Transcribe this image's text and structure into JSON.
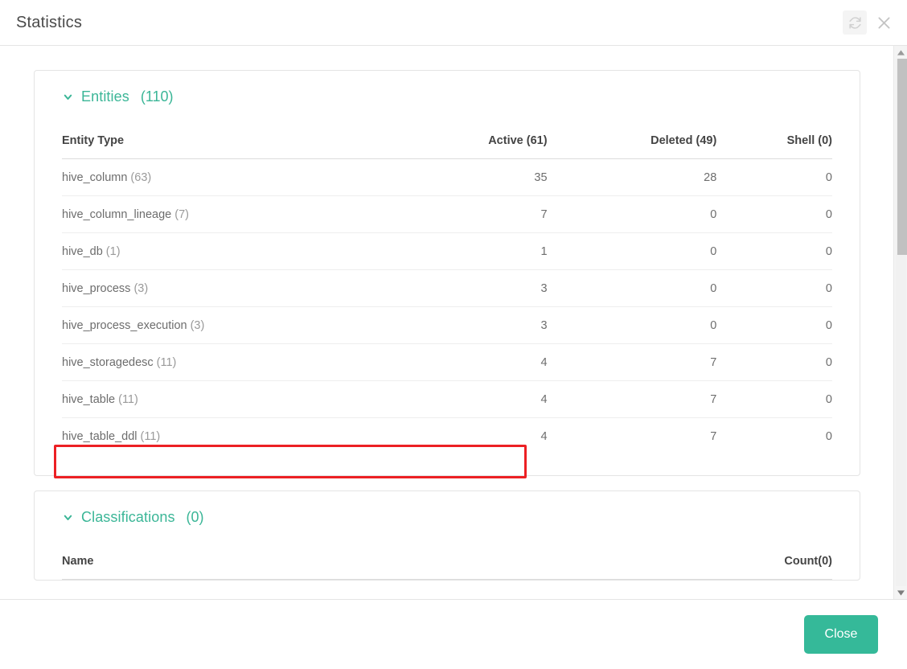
{
  "header": {
    "title": "Statistics",
    "refresh_icon": "refresh-icon",
    "close_icon": "close-icon"
  },
  "entities": {
    "chevron_icon": "chevron-down-icon",
    "title": "Entities",
    "count": "(110)",
    "columns": {
      "name": "Entity Type",
      "active": "Active",
      "active_count": "(61)",
      "deleted": "Deleted",
      "deleted_count": "(49)",
      "shell": "Shell",
      "shell_count": "(0)"
    },
    "rows": [
      {
        "name": "hive_column",
        "total": "(63)",
        "active": "35",
        "deleted": "28",
        "shell": "0",
        "highlighted": false
      },
      {
        "name": "hive_column_lineage",
        "total": "(7)",
        "active": "7",
        "deleted": "0",
        "shell": "0",
        "highlighted": false
      },
      {
        "name": "hive_db",
        "total": "(1)",
        "active": "1",
        "deleted": "0",
        "shell": "0",
        "highlighted": false
      },
      {
        "name": "hive_process",
        "total": "(3)",
        "active": "3",
        "deleted": "0",
        "shell": "0",
        "highlighted": false
      },
      {
        "name": "hive_process_execution",
        "total": "(3)",
        "active": "3",
        "deleted": "0",
        "shell": "0",
        "highlighted": false
      },
      {
        "name": "hive_storagedesc",
        "total": "(11)",
        "active": "4",
        "deleted": "7",
        "shell": "0",
        "highlighted": false
      },
      {
        "name": "hive_table",
        "total": "(11)",
        "active": "4",
        "deleted": "7",
        "shell": "0",
        "highlighted": true
      },
      {
        "name": "hive_table_ddl",
        "total": "(11)",
        "active": "4",
        "deleted": "7",
        "shell": "0",
        "highlighted": false
      }
    ]
  },
  "classifications": {
    "chevron_icon": "chevron-down-icon",
    "title": "Classifications",
    "count": "(0)",
    "columns": {
      "name": "Name",
      "count": "Count",
      "count_value": "(0)"
    },
    "rows": []
  },
  "footer": {
    "close_label": "Close"
  },
  "colors": {
    "accent": "#3bb697",
    "button": "#35b999",
    "active_value": "#4a90d9",
    "deleted_value": "#d9532c",
    "zero_value": "#8a8a8a",
    "highlight_box": "#ec2024"
  }
}
